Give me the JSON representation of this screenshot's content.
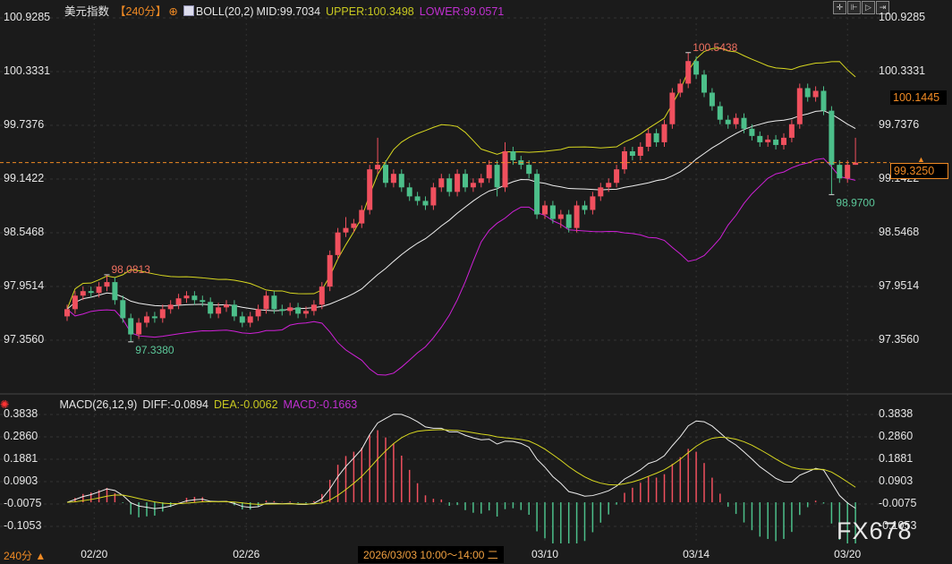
{
  "header": {
    "instrument": "美元指数",
    "period": "【240分】",
    "indicator": "BOLL(20,2)",
    "mid": "MID:99.7034",
    "upper": "UPPER:100.3498",
    "lower": "LOWER:99.0571"
  },
  "macd_header": {
    "name": "MACD(26,12,9)",
    "diff": "DIFF:-0.0894",
    "dea": "DEA:-0.0062",
    "macd": "MACD:-0.1663"
  },
  "toolbar": {
    "icons": [
      "crosshair-icon",
      "fit-left-icon",
      "play-right-icon",
      "jump-end-icon"
    ]
  },
  "colors": {
    "up": "#f0505e",
    "down": "#4cbf8a",
    "mid": "#eeeeee",
    "upper": "#d8d820",
    "lower": "#d020d8",
    "accent": "#f08a24",
    "bg": "#1b1b1b"
  },
  "price_box": {
    "last": "99.3250",
    "marker": "100.1445"
  },
  "bottom": {
    "period": "240分 ▲",
    "cursor_time": "2026/03/03 10:00～14:00 二"
  },
  "watermark": "FX678",
  "chart_data": [
    {
      "type": "candlestick",
      "title": "美元指数",
      "yticks": [
        "100.9285",
        "100.3331",
        "99.7376",
        "99.1422",
        "98.5468",
        "97.9514",
        "97.3560"
      ],
      "ylim": [
        97.0,
        100.9285
      ],
      "xticks": [
        {
          "label": "02/20",
          "candle_index": 3.4
        },
        {
          "label": "02/26",
          "candle_index": 22.5
        },
        {
          "label": "03/10",
          "candle_index": 60
        },
        {
          "label": "03/14",
          "candle_index": 79
        },
        {
          "label": "03/20",
          "candle_index": 98
        }
      ],
      "current_price": 99.325,
      "annotations": [
        {
          "text": "98.0813",
          "candle_index": 5,
          "value": 98.0813,
          "kind": "high"
        },
        {
          "text": "97.3380",
          "candle_index": 8,
          "value": 97.338,
          "kind": "low"
        },
        {
          "text": "100.5438",
          "candle_index": 78,
          "value": 100.5438,
          "kind": "high"
        },
        {
          "text": "98.9700",
          "candle_index": 96,
          "value": 98.97,
          "kind": "low"
        }
      ],
      "candles_ohlc": [
        [
          97.62,
          97.75,
          97.57,
          97.7
        ],
        [
          97.7,
          97.9,
          97.65,
          97.85
        ],
        [
          97.85,
          97.95,
          97.8,
          97.9
        ],
        [
          97.9,
          97.95,
          97.83,
          97.88
        ],
        [
          97.88,
          98.0,
          97.83,
          97.95
        ],
        [
          97.95,
          98.0813,
          97.9,
          98.0
        ],
        [
          98.0,
          98.05,
          97.75,
          97.8
        ],
        [
          97.8,
          97.85,
          97.55,
          97.6
        ],
        [
          97.6,
          97.65,
          97.338,
          97.42
        ],
        [
          97.42,
          97.6,
          97.37,
          97.55
        ],
        [
          97.55,
          97.67,
          97.5,
          97.62
        ],
        [
          97.62,
          97.67,
          97.55,
          97.6
        ],
        [
          97.6,
          97.75,
          97.55,
          97.7
        ],
        [
          97.7,
          97.8,
          97.65,
          97.75
        ],
        [
          97.75,
          97.87,
          97.7,
          97.82
        ],
        [
          97.82,
          97.9,
          97.77,
          97.85
        ],
        [
          97.85,
          97.9,
          97.75,
          97.8
        ],
        [
          97.8,
          97.85,
          97.73,
          97.78
        ],
        [
          97.78,
          97.83,
          97.6,
          97.65
        ],
        [
          97.65,
          97.77,
          97.6,
          97.72
        ],
        [
          97.72,
          97.8,
          97.67,
          97.75
        ],
        [
          97.75,
          97.8,
          97.57,
          97.62
        ],
        [
          97.62,
          97.67,
          97.5,
          97.55
        ],
        [
          97.55,
          97.67,
          97.5,
          97.62
        ],
        [
          97.62,
          97.75,
          97.57,
          97.7
        ],
        [
          97.7,
          97.9,
          97.65,
          97.85
        ],
        [
          97.85,
          97.9,
          97.65,
          97.7
        ],
        [
          97.7,
          97.75,
          97.63,
          97.68
        ],
        [
          97.68,
          97.77,
          97.63,
          97.72
        ],
        [
          97.72,
          97.77,
          97.6,
          97.65
        ],
        [
          97.65,
          97.73,
          97.6,
          97.68
        ],
        [
          97.68,
          97.8,
          97.63,
          97.75
        ],
        [
          97.75,
          98.0,
          97.7,
          97.95
        ],
        [
          97.95,
          98.35,
          97.9,
          98.3
        ],
        [
          98.3,
          98.6,
          98.25,
          98.55
        ],
        [
          98.55,
          98.72,
          98.5,
          98.6
        ],
        [
          98.6,
          98.7,
          98.55,
          98.65
        ],
        [
          98.65,
          98.85,
          98.6,
          98.8
        ],
        [
          98.8,
          99.3,
          98.75,
          99.25
        ],
        [
          99.25,
          99.6,
          99.2,
          99.3
        ],
        [
          99.3,
          99.35,
          99.05,
          99.1
        ],
        [
          99.1,
          99.25,
          99.05,
          99.2
        ],
        [
          99.2,
          99.25,
          99.0,
          99.05
        ],
        [
          99.05,
          99.1,
          98.9,
          98.95
        ],
        [
          98.95,
          99.0,
          98.85,
          98.9
        ],
        [
          98.9,
          98.95,
          98.8,
          98.85
        ],
        [
          98.85,
          99.1,
          98.8,
          99.05
        ],
        [
          99.05,
          99.2,
          99.0,
          99.15
        ],
        [
          99.15,
          99.2,
          98.95,
          99.0
        ],
        [
          99.0,
          99.25,
          98.95,
          99.2
        ],
        [
          99.2,
          99.25,
          99.0,
          99.05
        ],
        [
          99.05,
          99.15,
          99.0,
          99.1
        ],
        [
          99.1,
          99.2,
          99.05,
          99.15
        ],
        [
          99.15,
          99.35,
          99.1,
          99.3
        ],
        [
          99.3,
          99.35,
          98.95,
          99.05
        ],
        [
          99.05,
          99.55,
          99.0,
          99.45
        ],
        [
          99.45,
          99.5,
          99.3,
          99.35
        ],
        [
          99.35,
          99.4,
          99.25,
          99.3
        ],
        [
          99.3,
          99.35,
          99.15,
          99.2
        ],
        [
          99.2,
          99.25,
          98.7,
          98.75
        ],
        [
          98.75,
          98.9,
          98.7,
          98.85
        ],
        [
          98.85,
          98.9,
          98.65,
          98.7
        ],
        [
          98.7,
          98.8,
          98.6,
          98.75
        ],
        [
          98.75,
          98.8,
          98.55,
          98.6
        ],
        [
          98.6,
          98.9,
          98.55,
          98.85
        ],
        [
          98.85,
          98.9,
          98.75,
          98.8
        ],
        [
          98.8,
          99.0,
          98.75,
          98.95
        ],
        [
          98.95,
          99.1,
          98.9,
          99.05
        ],
        [
          99.05,
          99.15,
          99.0,
          99.1
        ],
        [
          99.1,
          99.3,
          99.05,
          99.25
        ],
        [
          99.25,
          99.5,
          99.2,
          99.45
        ],
        [
          99.45,
          99.5,
          99.35,
          99.4
        ],
        [
          99.4,
          99.55,
          99.35,
          99.5
        ],
        [
          99.5,
          99.7,
          99.45,
          99.65
        ],
        [
          99.65,
          99.7,
          99.5,
          99.55
        ],
        [
          99.55,
          99.8,
          99.5,
          99.75
        ],
        [
          99.75,
          100.15,
          99.7,
          100.1
        ],
        [
          100.1,
          100.25,
          100.05,
          100.2
        ],
        [
          100.2,
          100.5438,
          100.15,
          100.45
        ],
        [
          100.45,
          100.5,
          100.25,
          100.3
        ],
        [
          100.3,
          100.35,
          100.05,
          100.1
        ],
        [
          100.1,
          100.15,
          99.9,
          99.95
        ],
        [
          99.95,
          100.0,
          99.75,
          99.8
        ],
        [
          99.8,
          99.85,
          99.7,
          99.75
        ],
        [
          99.75,
          99.87,
          99.7,
          99.82
        ],
        [
          99.82,
          99.87,
          99.65,
          99.7
        ],
        [
          99.7,
          99.75,
          99.57,
          99.62
        ],
        [
          99.62,
          99.67,
          99.5,
          99.55
        ],
        [
          99.55,
          99.63,
          99.5,
          99.58
        ],
        [
          99.58,
          99.63,
          99.47,
          99.52
        ],
        [
          99.52,
          99.65,
          99.47,
          99.6
        ],
        [
          99.6,
          99.8,
          99.55,
          99.75
        ],
        [
          99.75,
          100.2,
          99.7,
          100.15
        ],
        [
          100.15,
          100.2,
          100.0,
          100.05
        ],
        [
          100.05,
          100.17,
          100.0,
          100.12
        ],
        [
          100.12,
          100.17,
          99.85,
          99.9
        ],
        [
          99.9,
          99.95,
          98.97,
          99.3
        ],
        [
          99.3,
          99.35,
          99.1,
          99.15
        ],
        [
          99.15,
          99.35,
          99.1,
          99.3
        ],
        [
          99.3,
          99.6,
          99.3,
          99.325
        ]
      ],
      "series": [
        {
          "name": "MID"
        },
        {
          "name": "UPPER"
        },
        {
          "name": "LOWER"
        }
      ]
    },
    {
      "type": "bar+line",
      "title": "MACD(26,12,9)",
      "yticks": [
        "0.3838",
        "0.2860",
        "0.1881",
        "0.0903",
        "-0.0075",
        "-0.1053"
      ],
      "ylim": [
        -0.2,
        0.42
      ],
      "series": [
        {
          "name": "DIFF"
        },
        {
          "name": "DEA"
        },
        {
          "name": "MACD"
        }
      ]
    }
  ]
}
